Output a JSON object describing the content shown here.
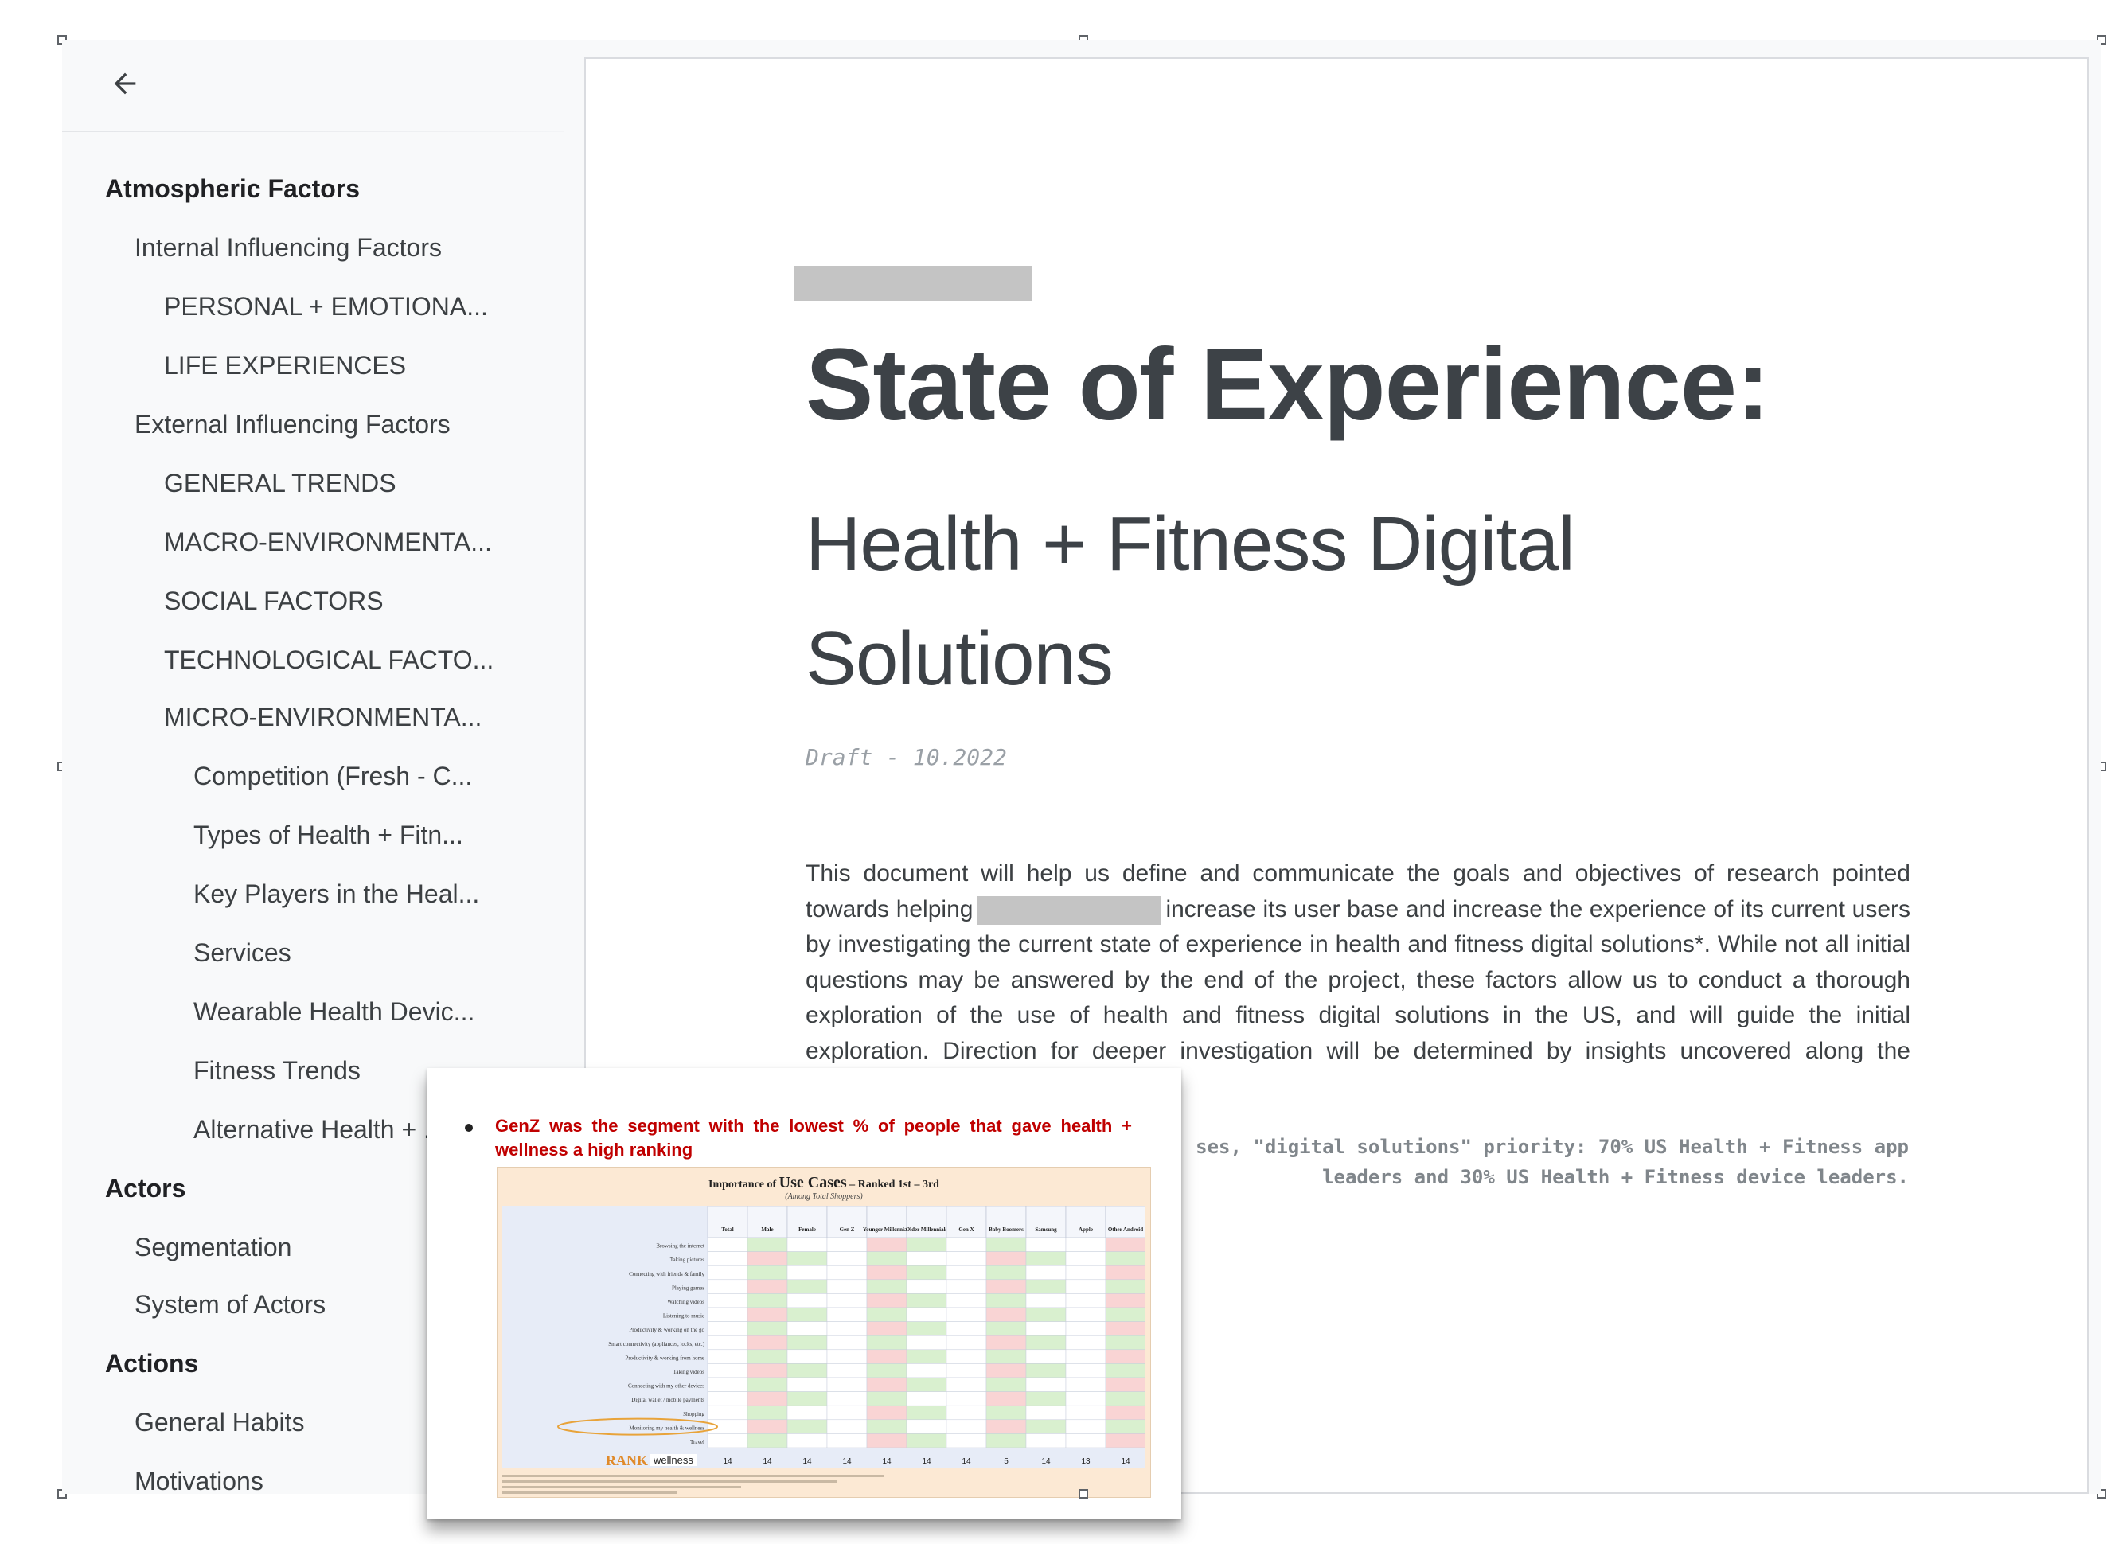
{
  "outline": {
    "back_icon": "arrow-left-icon",
    "items": [
      {
        "label": "Atmospheric Factors",
        "level": 1
      },
      {
        "label": "Internal Influencing Factors",
        "level": 2
      },
      {
        "label": "PERSONAL + EMOTIONA...",
        "level": 3
      },
      {
        "label": "LIFE EXPERIENCES",
        "level": 3
      },
      {
        "label": "External Influencing Factors",
        "level": 2
      },
      {
        "label": "GENERAL TRENDS",
        "level": 3
      },
      {
        "label": "MACRO-ENVIRONMENTA...",
        "level": 3
      },
      {
        "label": "SOCIAL FACTORS",
        "level": 3
      },
      {
        "label": "TECHNOLOGICAL FACTO...",
        "level": 3
      },
      {
        "label": "MICRO-ENVIRONMENTA...",
        "level": 3
      },
      {
        "label": "Competition (Fresh - C...",
        "level": 4
      },
      {
        "label": "Types of Health + Fitn...",
        "level": 4
      },
      {
        "label": "Key Players in the Heal...",
        "level": 4
      },
      {
        "label": "Services",
        "level": 4
      },
      {
        "label": "Wearable Health Devic...",
        "level": 4
      },
      {
        "label": "Fitness Trends",
        "level": 4
      },
      {
        "label": "Alternative Health + ...",
        "level": 4
      },
      {
        "label": "Actors",
        "level": 1
      },
      {
        "label": "Segmentation",
        "level": 2
      },
      {
        "label": "System of Actors",
        "level": 2
      },
      {
        "label": "Actions",
        "level": 1
      },
      {
        "label": "General Habits",
        "level": 2
      },
      {
        "label": "Motivations",
        "level": 2
      }
    ]
  },
  "document": {
    "title": "State of Experience:",
    "subtitle": "Health + Fitness Digital Solutions",
    "draft": "Draft - 10.2022",
    "body_lines": [
      "This document will help us define and communicate the goals and objectives of research pointed",
      "increase its user base and increase the experience of its current users",
      "by investigating the current state of experience in health and fitness digital solutions*. While not all initial",
      "questions may be answered by the end of the project, these factors allow us to conduct a thorough",
      "exploration of the use of health and fitness digital solutions in the US, and  will guide the initial",
      "exploration. Direction for deeper investigation will be determined by insights uncovered along the"
    ],
    "body_line2_prefix": "towards helping",
    "note": "ses, \"digital solutions\" priority: 70% US Health + Fitness app leaders and 30% US Health + Fitness device leaders."
  },
  "image": {
    "bullet": "GenZ was the segment with the lowest % of people that gave health + wellness a high ranking",
    "table_title_prefix": "Importance of",
    "table_title_big": "Use Cases",
    "table_title_suffix": "– Ranked 1st – 3rd",
    "table_subtitle": "(Among Total Shoppers)",
    "columns": [
      "Total",
      "Male",
      "Female",
      "Gen Z",
      "Younger Millennials",
      "Older Millennials",
      "Gen X",
      "Baby Boomers",
      "Samsung",
      "Apple",
      "Other Android"
    ],
    "rows": [
      "Browsing the internet",
      "Taking pictures",
      "Connecting with friends & family",
      "Playing games",
      "Watching videos",
      "Listening to music",
      "Productivity & working on the go",
      "Smart connectivity (appliances, locks, etc.)",
      "Productivity & working from home",
      "Taking videos",
      "Connecting with my other devices",
      "Digital wallet / mobile payments",
      "Shopping",
      "Monitoring my health & wellness",
      "Travel"
    ],
    "rank_label": "RANK",
    "rank_word": "wellness",
    "rank_values": [
      "14",
      "14",
      "14",
      "14",
      "14",
      "14",
      "14",
      "5",
      "14",
      "13",
      "14"
    ]
  }
}
